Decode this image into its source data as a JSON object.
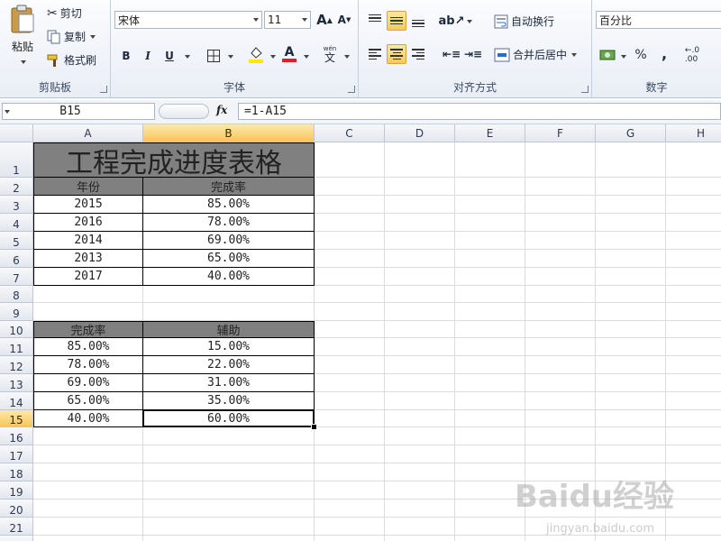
{
  "clipboard": {
    "paste_label": "粘贴",
    "cut_label": "剪切",
    "copy_label": "复制",
    "format_painter_label": "格式刷",
    "group_label": "剪贴板"
  },
  "font": {
    "name": "宋体",
    "size": "11",
    "bold": "B",
    "italic": "I",
    "underline": "U",
    "grow": "A",
    "shrink": "A",
    "wen": "wén",
    "wen_char": "文",
    "group_label": "字体",
    "font_color": "#e02020",
    "fill_color": "#ffe900"
  },
  "alignment": {
    "wrap_label": "自动换行",
    "merge_label": "合并后居中",
    "group_label": "对齐方式"
  },
  "number": {
    "format": "百分比",
    "percent": "%",
    "comma": ",",
    "group_label": "数字"
  },
  "formula_bar": {
    "name_box": "B15",
    "fx": "fx",
    "formula": "=1-A15"
  },
  "columns": [
    "A",
    "B",
    "C",
    "D",
    "E",
    "F",
    "G",
    "H"
  ],
  "rows": [
    "1",
    "2",
    "3",
    "4",
    "5",
    "6",
    "7",
    "8",
    "9",
    "10",
    "11",
    "12",
    "13",
    "14",
    "15",
    "16",
    "17",
    "18",
    "19",
    "20",
    "21",
    "22"
  ],
  "table1": {
    "title": "工程完成进度表格",
    "headers": [
      "年份",
      "完成率"
    ],
    "data": [
      [
        "2015",
        "85.00%"
      ],
      [
        "2016",
        "78.00%"
      ],
      [
        "2014",
        "69.00%"
      ],
      [
        "2013",
        "65.00%"
      ],
      [
        "2017",
        "40.00%"
      ]
    ]
  },
  "table2": {
    "headers": [
      "完成率",
      "辅助"
    ],
    "data": [
      [
        "85.00%",
        "15.00%"
      ],
      [
        "78.00%",
        "22.00%"
      ],
      [
        "69.00%",
        "31.00%"
      ],
      [
        "65.00%",
        "35.00%"
      ],
      [
        "40.00%",
        "60.00%"
      ]
    ]
  },
  "selected_cell": "B15",
  "watermark": {
    "logo": "Baidu经验",
    "url": "jingyan.baidu.com"
  }
}
